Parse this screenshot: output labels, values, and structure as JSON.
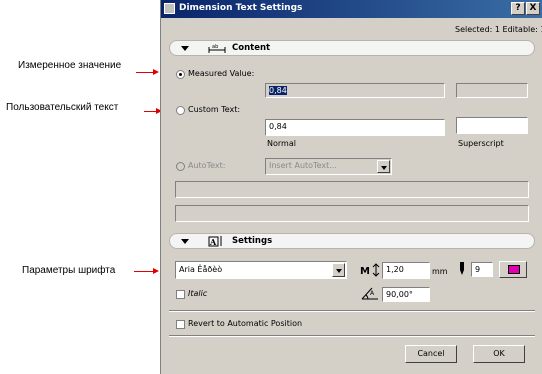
{
  "annotations": {
    "measured": "Измеренное значение",
    "custom": "Пользовательский текст",
    "font": "Параметры шрифта"
  },
  "dialog": {
    "title": "Dimension Text Settings",
    "help_label": "?",
    "close_label": "X",
    "status": "Selected: 1 Editable: 1"
  },
  "content": {
    "section_title": "Content",
    "measured_label": "Measured Value:",
    "measured_value": "0,84",
    "measured_value_selected": true,
    "custom_label": "Custom Text:",
    "custom_value": "0,84",
    "normal_label": "Normal",
    "superscript_label": "Superscript",
    "autotext_label": "AutoText:",
    "autotext_placeholder": "Insert AutoText..."
  },
  "settings": {
    "section_title": "Settings",
    "font_name": "Aria Êåðèò",
    "font_size": "1,20",
    "size_unit": "mm",
    "pen_number": "9",
    "pen_color": "#e000b0",
    "italic_label": "Italic",
    "angle": "90,00°",
    "revert_label": "Revert to Automatic Position"
  },
  "buttons": {
    "cancel": "Cancel",
    "ok": "OK"
  },
  "colors": {
    "annotation_arrow": "#e00000",
    "title_bar": "#0a246a",
    "dialog_bg": "#d4d0c8"
  }
}
